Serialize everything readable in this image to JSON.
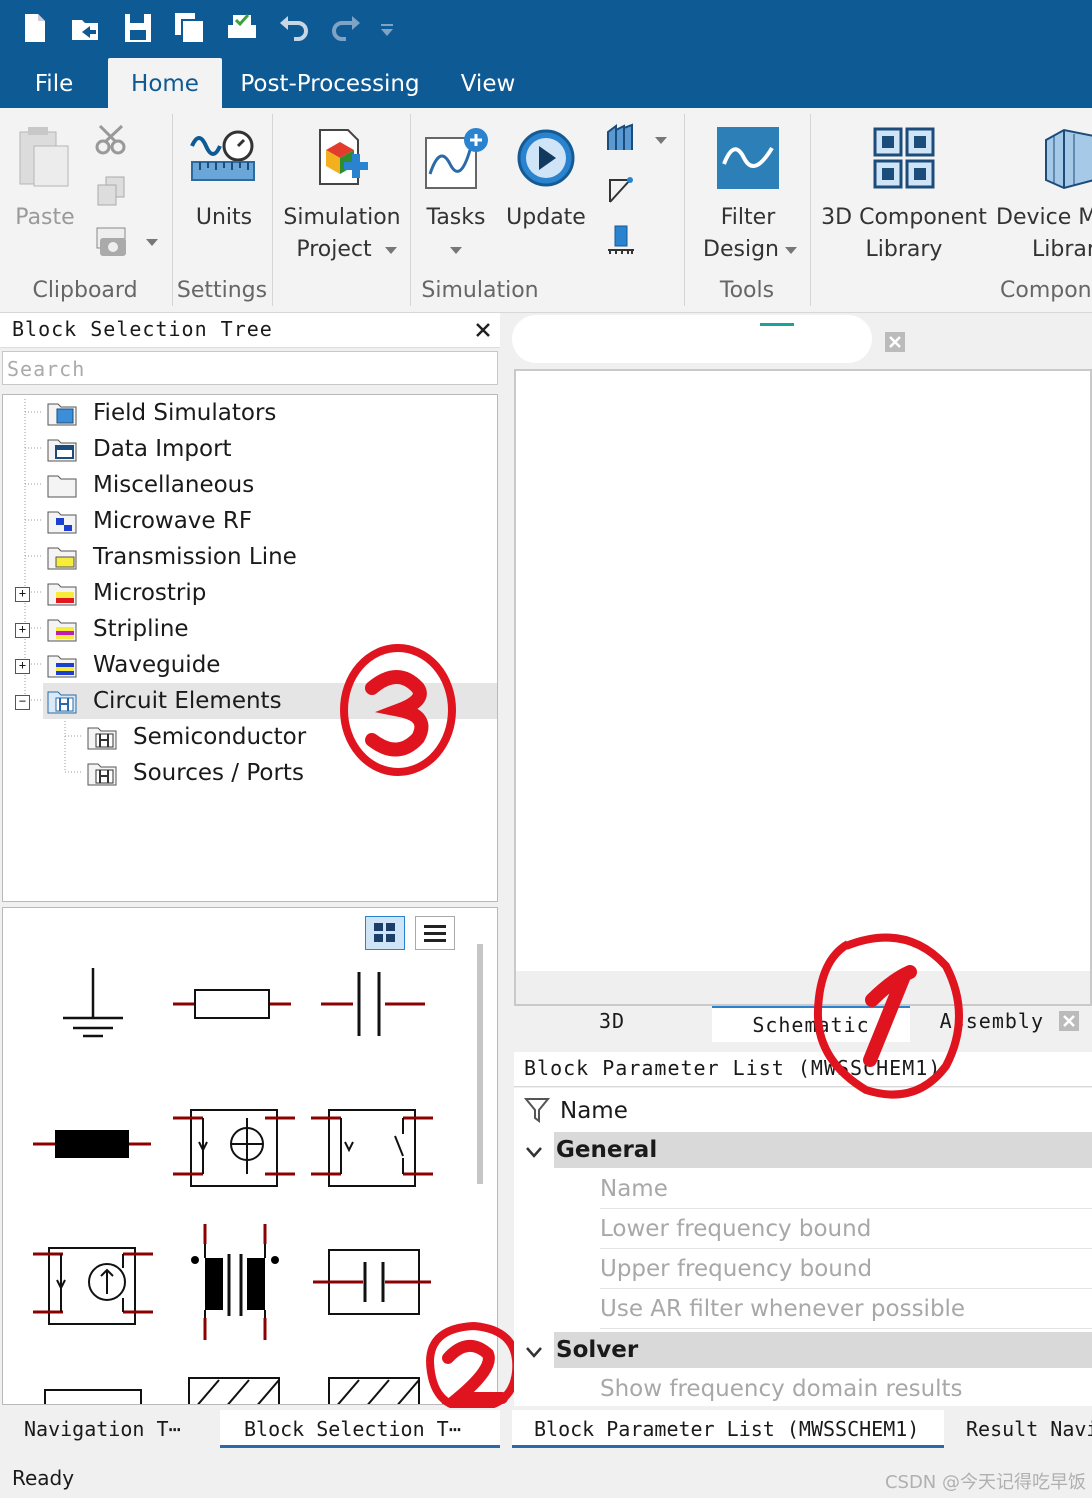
{
  "quick_access": [
    "new-file-icon",
    "open-icon",
    "save-icon",
    "save-all-icon",
    "print-icon",
    "undo-icon",
    "redo-icon",
    "customize-icon"
  ],
  "tabs": {
    "file": "File",
    "home": "Home",
    "post": "Post-Processing",
    "view": "View"
  },
  "ribbon": {
    "paste": "Paste",
    "units": "Units",
    "sim_project_1": "Simulation",
    "sim_project_2": "Project",
    "tasks": "Tasks",
    "update": "Update",
    "filter_1": "Filter",
    "filter_2": "Design",
    "comp_lib_1": "3D Component",
    "comp_lib_2": "Library",
    "device_1": "Device M",
    "device_2": "Librar",
    "groups": {
      "clipboard": "Clipboard",
      "settings": "Settings",
      "simulation": "Simulation",
      "tools": "Tools",
      "components": "Compon"
    }
  },
  "left_panel": {
    "title": "Block Selection Tree",
    "search_placeholder": "Search",
    "tree": [
      {
        "label": "Field Simulators"
      },
      {
        "label": "Data Import"
      },
      {
        "label": "Miscellaneous"
      },
      {
        "label": "Microwave RF"
      },
      {
        "label": "Transmission Line"
      },
      {
        "label": "Microstrip"
      },
      {
        "label": "Stripline"
      },
      {
        "label": "Waveguide"
      },
      {
        "label": "Circuit Elements"
      },
      {
        "label": "Semiconductor"
      },
      {
        "label": "Sources / Ports"
      }
    ]
  },
  "view_tabs": {
    "t3d": "3D",
    "schematic": "Schematic",
    "assembly": "Assembly"
  },
  "bpl": {
    "title": "Block Parameter List (MWSSCHEM1)",
    "column": "Name",
    "categories": {
      "general": "General",
      "solver": "Solver"
    },
    "general_rows": [
      "Name",
      "Lower frequency bound",
      "Upper frequency bound",
      "Use AR filter whenever possible"
    ],
    "solver_rows": [
      "Show frequency domain results"
    ]
  },
  "bottom_tabs": {
    "nav": "Navigation T⋯",
    "bst": "Block Selection T⋯",
    "bpl": "Block Parameter List (MWSSCHEM1)",
    "result": "Result Navi"
  },
  "status": "Ready",
  "watermark": "CSDN @今天记得吃早饭",
  "annotations": [
    "3",
    "1",
    "2"
  ],
  "colors": {
    "brand": "#0e5a94",
    "annotation": "#e0141e",
    "selected_row": "#e5e5e5"
  }
}
